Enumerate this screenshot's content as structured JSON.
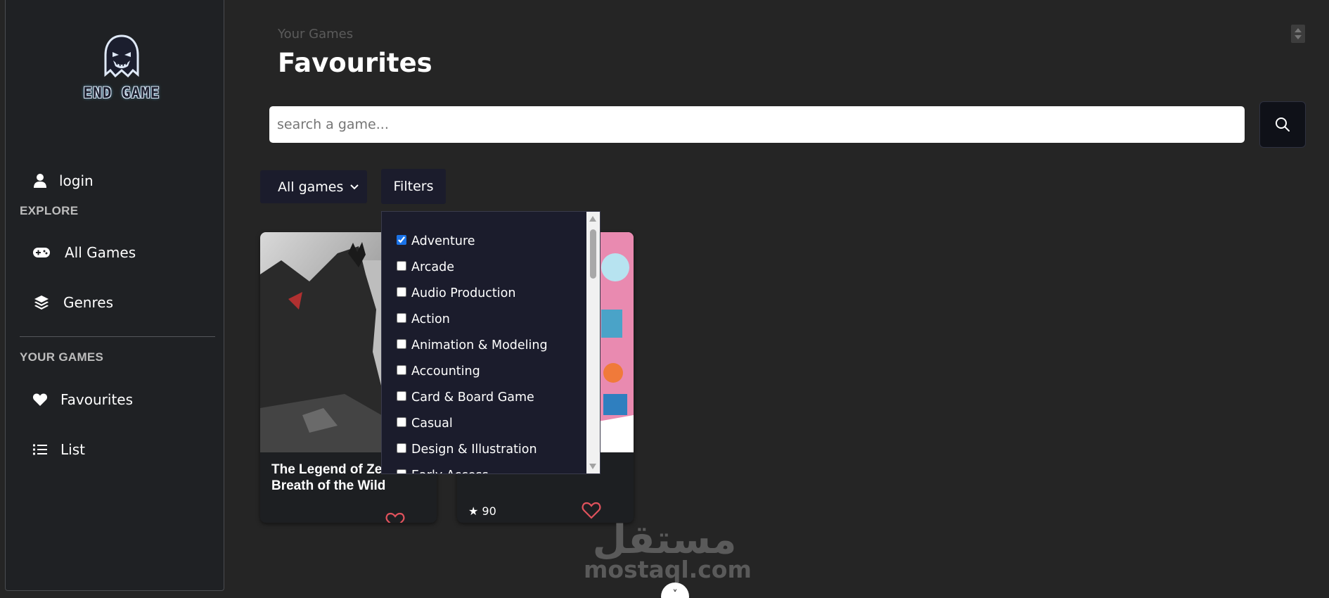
{
  "brand": {
    "name": "END GAME",
    "logo_icon": "ghost-icon"
  },
  "sidebar": {
    "login": {
      "label": "login",
      "icon": "user-icon"
    },
    "explore_title": "EXPLORE",
    "explore_items": [
      {
        "label": "All Games",
        "icon": "gamepad-icon"
      },
      {
        "label": "Genres",
        "icon": "layers-icon"
      }
    ],
    "your_games_title": "YOUR GAMES",
    "your_games_items": [
      {
        "label": "Favourites",
        "icon": "heart-icon"
      },
      {
        "label": "List",
        "icon": "list-icon"
      }
    ]
  },
  "header": {
    "breadcrumb": "Your Games",
    "title": "Favourites"
  },
  "search": {
    "placeholder": "search a game...",
    "value": ""
  },
  "controls": {
    "select": {
      "selected": "All games"
    },
    "filters_label": "Filters"
  },
  "filters": {
    "options": [
      {
        "label": "Adventure",
        "checked": true
      },
      {
        "label": "Arcade",
        "checked": false
      },
      {
        "label": "Audio Production",
        "checked": false
      },
      {
        "label": "Action",
        "checked": false
      },
      {
        "label": "Animation & Modeling",
        "checked": false
      },
      {
        "label": "Accounting",
        "checked": false
      },
      {
        "label": "Card & Board Game",
        "checked": false
      },
      {
        "label": "Casual",
        "checked": false
      },
      {
        "label": "Design & Illustration",
        "checked": false
      },
      {
        "label": "Early Access",
        "checked": false
      }
    ]
  },
  "cards": [
    {
      "title": "The Legend of Zelda: Breath of the Wild",
      "rating": ""
    },
    {
      "title": "",
      "rating": "★ 90"
    }
  ],
  "colors": {
    "background": "#252525",
    "sidebar": "#1f2124",
    "control": "#1b1c2c",
    "heart": "#e0525c"
  },
  "watermark": {
    "arabic": "مستقل",
    "latin": "mostaql.com"
  }
}
